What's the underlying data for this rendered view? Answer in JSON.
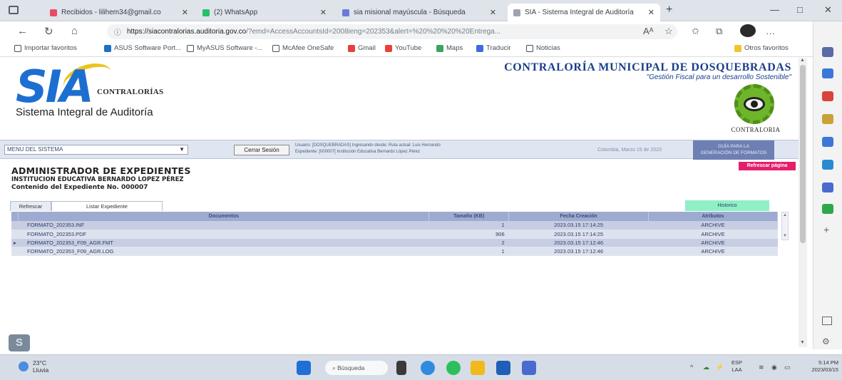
{
  "browser": {
    "tabs": [
      {
        "title": "Recibidos - lilihem34@gmail.co",
        "fav_color": "#e84c64"
      },
      {
        "title": "(2) WhatsApp",
        "fav_color": "#25c16b"
      },
      {
        "title": "sia misional mayúscula - Búsqueda",
        "fav_color": "#6a7adb"
      },
      {
        "title": "SIA - Sistema Integral de Auditoría",
        "fav_color": "#9ea4ad"
      }
    ],
    "new_tab": "+",
    "window_controls": [
      "—",
      "□",
      "✕"
    ],
    "url_host": "https://siacontralorias.auditoria.gov.co",
    "url_rest": "/?emd=AccessAccountsId=2008ieng=202353&alert=%20%20%20%20Entrega...",
    "nav": [
      "←",
      "↻",
      "⌂"
    ],
    "toolbar_icons": [
      "Aᴬ",
      "☆",
      "✩",
      "⧉",
      "…",
      "b"
    ],
    "bookmarks": [
      {
        "label": "Importar favoritos",
        "color": "#4a4f55"
      },
      {
        "label": "ASUS Software Port...",
        "color": "#1e6fc7"
      },
      {
        "label": "MyASUS Software -...",
        "color": "#4a4f55"
      },
      {
        "label": "McAfee OneSafe",
        "color": "#4a4f55"
      },
      {
        "label": "Gmail",
        "color": "#e8403a"
      },
      {
        "label": "YouTube",
        "color": "#e8403a"
      },
      {
        "label": "Maps",
        "color": "#3aa55c"
      },
      {
        "label": "Traducir",
        "color": "#3a6ede"
      },
      {
        "label": "Noticias",
        "color": "#4a4f55"
      }
    ],
    "other_bookmarks": "Otros favoritos",
    "sidebar_colors": [
      "#5a6aa5",
      "#3a78d8",
      "#d8433a",
      "#c8a238",
      "#3a78d8",
      "#2a8ad0",
      "#4a6ad0",
      "#2ca84a"
    ],
    "sidebar_add": "+"
  },
  "page": {
    "logo_main": "SIA",
    "logo_side": "CONTRALORÍAS",
    "logo_tagline": "Sistema Integral de Auditoría",
    "muni_title": "CONTRALORÍA MUNICIPAL DE DOSQUEBRADAS",
    "muni_subtitle": "\"Gestión Fiscal para un desarrollo Sostenible\"",
    "gear_label": "CONTRALORIA",
    "menu_select": "MENU DEL SISTEMA",
    "logout_label": "Cerrar Sesión",
    "user_line1": "Usuario: [DOSQUEBRADAS] Ingresando desde: Ruta actual: Luis Hernando",
    "user_line2": "Expediente: [000007] Institución Educativa Bernardo López Pérez",
    "date_text": "Colombia, Marzo 15 de 2023",
    "guide_line1": "GUÍA PARA LA",
    "guide_line2": "GENERACIÓN DE FORMATOS",
    "refresh_label": "Refrescar página",
    "admin_title": "ADMINISTRADOR DE EXPEDIENTES",
    "institution": "INSTITUCION EDUCATIVA BERNARDO LOPEZ PÉREZ",
    "expediente": "Contenido del Expediente No. 000007",
    "subtabs": [
      "Refrescar",
      "Listar Expediente"
    ],
    "history_label": "Historico",
    "table": {
      "headers": [
        "",
        "Documentos",
        "Tamaño (KB)",
        "Fecha Creación",
        "Atributos"
      ],
      "rows": [
        {
          "mark": "",
          "doc": "FORMATO_202353.INF",
          "size": "1",
          "date": "2023.03.15 17:14:25",
          "attr": "ARCHIVE"
        },
        {
          "mark": "",
          "doc": "FORMATO_202353.PDF",
          "size": "906",
          "date": "2023.03.15 17:14:25",
          "attr": "ARCHIVE"
        },
        {
          "mark": "▸",
          "doc": "FORMATO_202353_F09_AGR.FMT",
          "size": "2",
          "date": "2023.03.15 17:12:46",
          "attr": "ARCHIVE"
        },
        {
          "mark": "",
          "doc": "FORMATO_202353_F09_AGR.LOG",
          "size": "1",
          "date": "2023.03.15 17:12:46",
          "attr": "ARCHIVE"
        }
      ]
    }
  },
  "taskbar": {
    "temp": "23°C",
    "weather": "Lluvia",
    "search": "Búsqueda",
    "lang1": "ESP",
    "lang2": "LAA",
    "time": "5:14 PM",
    "date": "2023/03/15",
    "tray_icons": [
      "^",
      "☁",
      "⚡"
    ],
    "app_colors": [
      "#1f6fd6",
      "#3a3a3a",
      "#2f8be0",
      "#2bbf5e",
      "#f2b91c",
      "#1e5fb7",
      "#4a6ad0"
    ]
  }
}
